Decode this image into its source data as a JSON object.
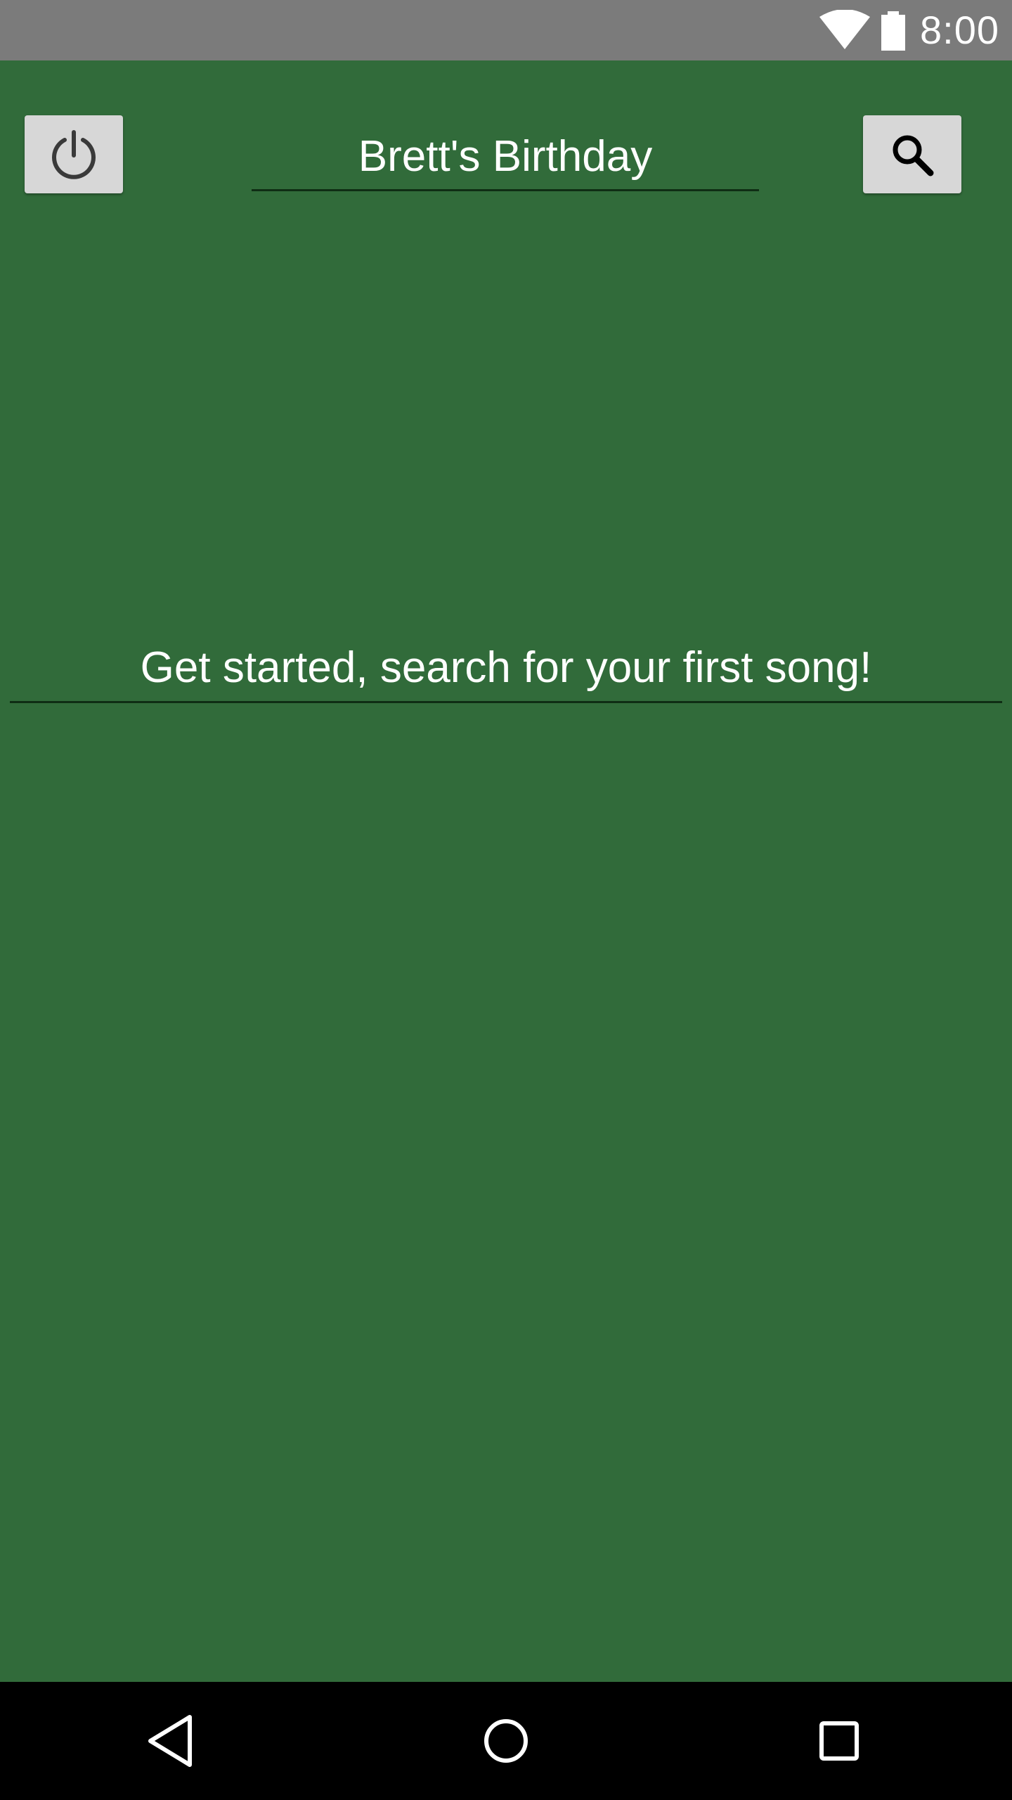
{
  "status_bar": {
    "time": "8:00",
    "icons": [
      "wifi-icon",
      "battery-icon"
    ]
  },
  "header": {
    "power_button_icon": "power-icon",
    "party_name": "Brett's Birthday",
    "search_button_icon": "search-icon"
  },
  "main": {
    "empty_message": "Get started, search for your first song!"
  },
  "nav_bar": {
    "icons": [
      "back-icon",
      "home-icon",
      "recents-icon"
    ]
  },
  "colors": {
    "background": "#316b3a",
    "status_bar": "#7b7b7b",
    "button": "#d7d7d7",
    "nav_bar": "#000000",
    "text": "#ffffff"
  }
}
